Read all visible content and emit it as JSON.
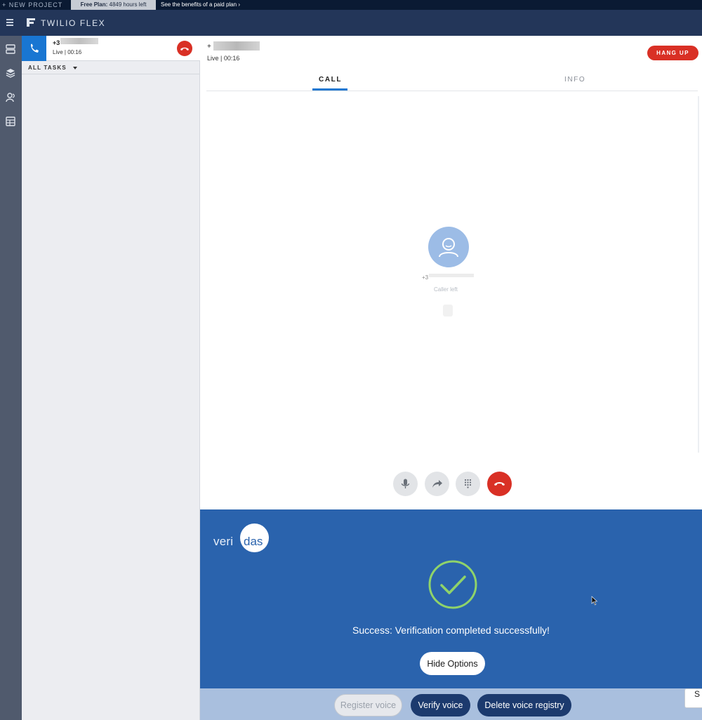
{
  "topbar": {
    "new_project": "+  NEW PROJECT",
    "plan_bold": "Free Plan:",
    "plan_rest": " 4849 hours left",
    "benefits": "See the benefits of a paid plan"
  },
  "header": {
    "brand": "TWILIO FLEX"
  },
  "rail": {
    "icons": [
      "task-list-icon",
      "layers-icon",
      "teams-icon",
      "dashboard-icon"
    ]
  },
  "task_list": {
    "task": {
      "number": "+3",
      "status": "Live | 00:16"
    },
    "filter_label": "ALL TASKS"
  },
  "call": {
    "number": "+",
    "status": "Live | 00:16",
    "hangup_label": "HANG UP",
    "tabs": [
      "CALL",
      "INFO"
    ],
    "participant_number": "+3",
    "participant_status": "Caller left"
  },
  "veridas": {
    "logo_left": "veri",
    "logo_right": "das",
    "message": "Success: Verification completed successfully!",
    "hide_options_label": "Hide Options",
    "options": {
      "register_label": "Register voice",
      "verify_label": "Verify voice",
      "delete_label": "Delete voice registry"
    },
    "edge_button_label": "S"
  },
  "colors": {
    "header": "#233659",
    "accent_blue": "#1976d2",
    "hangup_red": "#d93025",
    "veridas_blue": "#2a63ad",
    "success_green": "#8fd36a"
  }
}
